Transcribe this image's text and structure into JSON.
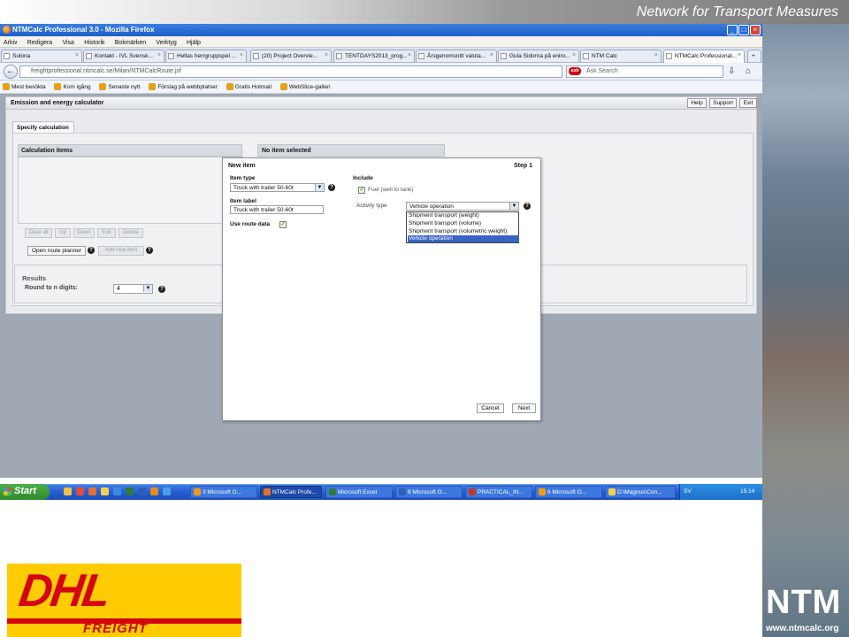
{
  "banner": {
    "title": "Network for Transport Measures"
  },
  "window": {
    "title": "NTMCalc Professional 3.0 - Mozilla Firefox",
    "buttons": [
      "_",
      "□",
      "×"
    ]
  },
  "menu": [
    "Arkiv",
    "Redigera",
    "Visa",
    "Historik",
    "Bokmärken",
    "Verktyg",
    "Hjälp"
  ],
  "tabs": [
    {
      "label": "Sulona"
    },
    {
      "label": "Kontakt - IVL Svensk..."
    },
    {
      "label": "Hellas herrgruppspel ..."
    },
    {
      "label": "(20) Project Overvie..."
    },
    {
      "label": "TENTDAYS2013_prog..."
    },
    {
      "label": "Årsgenomsnitt valuta..."
    },
    {
      "label": "Gula Sidorna på eniro..."
    },
    {
      "label": "NTM Calc"
    },
    {
      "label": "NTMCalc Professional..."
    }
  ],
  "tab_close": "×",
  "new_tab": "+",
  "nav": {
    "back": "←",
    "url": "freightprofessional.ntmcalc.se/Milan/NTMCalcRoute.jsf",
    "search_placeholder": "Ask Search",
    "search_engine": "ask"
  },
  "bookmarks": [
    "Mest besökta",
    "Kom igång",
    "Senaste nytt",
    "Förslag på webbplatser",
    "Gratis Hotmail",
    "WebSlice-galleri"
  ],
  "app": {
    "title": "Emission and energy calculator",
    "header_buttons": [
      "Help",
      "Support",
      "Exit"
    ],
    "tab": "Specify calculation",
    "calc_items_title": "Calculation items",
    "no_item_title": "No item selected",
    "item_buttons": [
      "Clear all",
      "Up",
      "Down",
      "Edit",
      "Delete"
    ],
    "open_route": "Open route planner",
    "add_new_item": "Add new item",
    "results_title": "Results",
    "round_label": "Round to n digits:",
    "round_value": "4"
  },
  "dialog": {
    "title": "New item",
    "step": "Step 1",
    "item_type_label": "Item type",
    "item_type_value": "Truck with trailer 50-60t",
    "item_label_label": "Item label",
    "item_label_value": "Truck with trailer 50-60t",
    "use_route_label": "Use route data",
    "include_label": "Include",
    "fuel_label": "Fuel (well to tank)",
    "activity_label": "Activity type",
    "activity_value": "Vehicle operation",
    "options": [
      "Shipment transport (weight)",
      "Shipment transport (volume)",
      "Shipment transport (volumetric weight)",
      "Vehicle operation"
    ],
    "cancel": "Cancel",
    "next": "Next"
  },
  "taskbar": {
    "start": "Start",
    "items": [
      "3 Microsoft O...",
      "NTMCalc Profe...",
      "Microsoft Excel",
      "8 Microsoft O...",
      "PRACTICAL_IN...",
      "6 Microsoft O...",
      "D:\\Magnus\\Con..."
    ],
    "tray_lang": "SV",
    "clock": "15:14"
  },
  "ntm": {
    "logo": "NTM",
    "url": "www.ntmcalc.org"
  },
  "dhl": {
    "logo": "DHL",
    "sub": "FREIGHT"
  }
}
